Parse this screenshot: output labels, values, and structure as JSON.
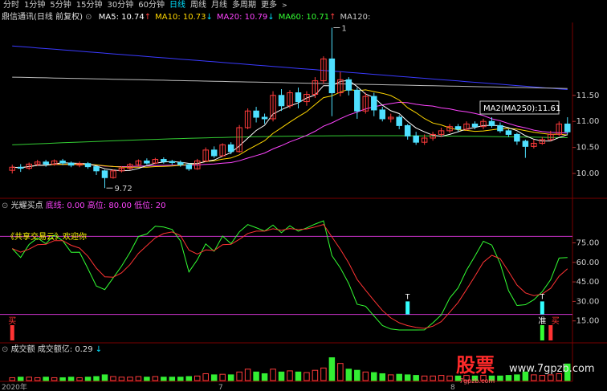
{
  "toolbar": {
    "periods": [
      "分时",
      "1分钟",
      "5分钟",
      "15分钟",
      "30分钟",
      "60分钟",
      "日线",
      "周线",
      "月线",
      "多周期",
      "更多"
    ],
    "active_index": 6,
    "more_caret": ">"
  },
  "main_panel": {
    "title": "鼎信通讯(日线 前复权)",
    "ma_labels": [
      {
        "text": "MA5: 10.74",
        "color": "#ffffff"
      },
      {
        "text": "MA10: 10.73",
        "color": "#ffd700"
      },
      {
        "text": "MA20: 10.79",
        "color": "#ff44ff"
      },
      {
        "text": "MA60: 10.71",
        "color": "#33ff33"
      },
      {
        "text": "MA120:",
        "color": "#cccccc"
      }
    ],
    "arrows": [
      "↑",
      "↓",
      "↓",
      "↑"
    ],
    "peak_label": "1",
    "low_label": "9.72",
    "tooltip": "MA2(MA250):11.61",
    "price_ticks": [
      {
        "label": "11.50",
        "value": 11.5
      },
      {
        "label": "11.00",
        "value": 11.0
      },
      {
        "label": "10.50",
        "value": 10.5
      },
      {
        "label": "10.00",
        "value": 10.0
      }
    ]
  },
  "indicator_panel": {
    "title": "光耀买点",
    "base": "底线: 0.00",
    "high": "高位: 80.00",
    "low": "低位: 20",
    "slogan": "《共享交易云》欢迎你",
    "buy_label": "买",
    "zhun_label": "准",
    "t_label": "T",
    "ticks": [
      {
        "label": "75.00",
        "value": 75
      },
      {
        "label": "60.00",
        "value": 60
      },
      {
        "label": "45.00",
        "value": 45
      },
      {
        "label": "30.00",
        "value": 30
      },
      {
        "label": "15.00",
        "value": 15
      }
    ]
  },
  "volume_panel": {
    "title": "成交额",
    "sub": "成交额亿: 0.29",
    "arrow": "↓",
    "date_left": "2020年",
    "date_mid": "7",
    "date_right": "8"
  },
  "watermark": {
    "big": "股票",
    "site": "www.7gpzb.com",
    "small": "7gpzb.com"
  },
  "chart_data": {
    "type": "candlestick",
    "candles": [
      [
        10.06,
        10.12,
        10.0,
        10.17
      ],
      [
        10.12,
        10.1,
        10.03,
        10.18
      ],
      [
        10.1,
        10.18,
        10.07,
        10.21
      ],
      [
        10.18,
        10.22,
        10.14,
        10.26
      ],
      [
        10.22,
        10.18,
        10.13,
        10.26
      ],
      [
        10.18,
        10.24,
        10.15,
        10.27
      ],
      [
        10.24,
        10.2,
        10.16,
        10.28
      ],
      [
        10.2,
        10.16,
        10.12,
        10.23
      ],
      [
        10.16,
        10.19,
        10.12,
        10.23
      ],
      [
        10.19,
        10.13,
        10.09,
        10.22
      ],
      [
        10.13,
        10.05,
        9.97,
        10.15
      ],
      [
        10.05,
        9.92,
        9.72,
        10.07
      ],
      [
        9.92,
        10.05,
        9.9,
        10.08
      ],
      [
        10.05,
        10.1,
        10.02,
        10.14
      ],
      [
        10.1,
        10.17,
        10.07,
        10.2
      ],
      [
        10.17,
        10.24,
        10.14,
        10.27
      ],
      [
        10.24,
        10.2,
        10.17,
        10.29
      ],
      [
        10.2,
        10.27,
        10.18,
        10.3
      ],
      [
        10.27,
        10.23,
        10.19,
        10.31
      ],
      [
        10.23,
        10.21,
        10.17,
        10.26
      ],
      [
        10.21,
        10.17,
        10.13,
        10.25
      ],
      [
        10.17,
        10.09,
        10.05,
        10.2
      ],
      [
        10.09,
        10.24,
        10.07,
        10.28
      ],
      [
        10.24,
        10.45,
        10.22,
        10.5
      ],
      [
        10.45,
        10.34,
        10.3,
        10.52
      ],
      [
        10.34,
        10.55,
        10.32,
        10.58
      ],
      [
        10.55,
        10.42,
        10.37,
        10.6
      ],
      [
        10.42,
        10.88,
        10.4,
        10.93
      ],
      [
        10.88,
        11.2,
        10.85,
        11.25
      ],
      [
        11.2,
        11.08,
        10.98,
        11.28
      ],
      [
        11.08,
        11.05,
        10.95,
        11.15
      ],
      [
        11.05,
        11.5,
        11.0,
        11.58
      ],
      [
        11.5,
        11.3,
        11.2,
        11.62
      ],
      [
        11.3,
        11.55,
        11.25,
        11.6
      ],
      [
        11.55,
        11.38,
        11.25,
        11.65
      ],
      [
        11.38,
        11.52,
        11.3,
        11.58
      ],
      [
        11.52,
        11.78,
        11.45,
        11.85
      ],
      [
        11.78,
        12.2,
        11.72,
        12.25
      ],
      [
        12.2,
        11.55,
        11.1,
        12.8
      ],
      [
        11.55,
        11.8,
        11.48,
        11.95
      ],
      [
        11.8,
        11.6,
        11.5,
        11.85
      ],
      [
        11.6,
        11.2,
        11.05,
        11.65
      ],
      [
        11.2,
        11.48,
        11.15,
        11.55
      ],
      [
        11.48,
        11.22,
        11.1,
        11.55
      ],
      [
        11.22,
        11.05,
        11.0,
        11.28
      ],
      [
        11.05,
        11.08,
        10.98,
        11.15
      ],
      [
        11.08,
        10.92,
        10.85,
        11.12
      ],
      [
        10.92,
        10.72,
        10.65,
        10.95
      ],
      [
        10.72,
        10.6,
        10.55,
        10.8
      ],
      [
        10.6,
        10.68,
        10.55,
        10.75
      ],
      [
        10.68,
        10.75,
        10.63,
        10.8
      ],
      [
        10.75,
        10.82,
        10.7,
        10.88
      ],
      [
        10.82,
        10.9,
        10.78,
        10.95
      ],
      [
        10.9,
        10.85,
        10.8,
        10.95
      ],
      [
        10.85,
        10.95,
        10.82,
        11.0
      ],
      [
        10.95,
        10.9,
        10.85,
        11.0
      ],
      [
        10.9,
        11.0,
        10.85,
        11.05
      ],
      [
        11.0,
        10.92,
        10.88,
        11.08
      ],
      [
        10.92,
        10.82,
        10.78,
        10.98
      ],
      [
        10.82,
        10.75,
        10.7,
        10.85
      ],
      [
        10.75,
        10.62,
        10.55,
        10.78
      ],
      [
        10.62,
        10.52,
        10.3,
        10.65
      ],
      [
        10.52,
        10.58,
        10.48,
        10.65
      ],
      [
        10.58,
        10.65,
        10.55,
        10.7
      ],
      [
        10.65,
        10.75,
        10.62,
        10.82
      ],
      [
        10.75,
        10.95,
        10.72,
        11.0
      ],
      [
        10.95,
        10.8,
        10.75,
        11.08
      ]
    ],
    "volumes": [
      0.05,
      0.06,
      0.06,
      0.05,
      0.06,
      0.05,
      0.05,
      0.06,
      0.05,
      0.06,
      0.07,
      0.1,
      0.07,
      0.06,
      0.06,
      0.07,
      0.06,
      0.07,
      0.06,
      0.06,
      0.06,
      0.07,
      0.08,
      0.12,
      0.1,
      0.11,
      0.1,
      0.15,
      0.2,
      0.15,
      0.12,
      0.2,
      0.15,
      0.17,
      0.15,
      0.14,
      0.18,
      0.22,
      0.4,
      0.3,
      0.2,
      0.18,
      0.15,
      0.14,
      0.12,
      0.1,
      0.11,
      0.1,
      0.09,
      0.08,
      0.08,
      0.09,
      0.08,
      0.08,
      0.09,
      0.08,
      0.09,
      0.08,
      0.08,
      0.09,
      0.1,
      0.15,
      0.1,
      0.09,
      0.1,
      0.12,
      0.29
    ]
  }
}
